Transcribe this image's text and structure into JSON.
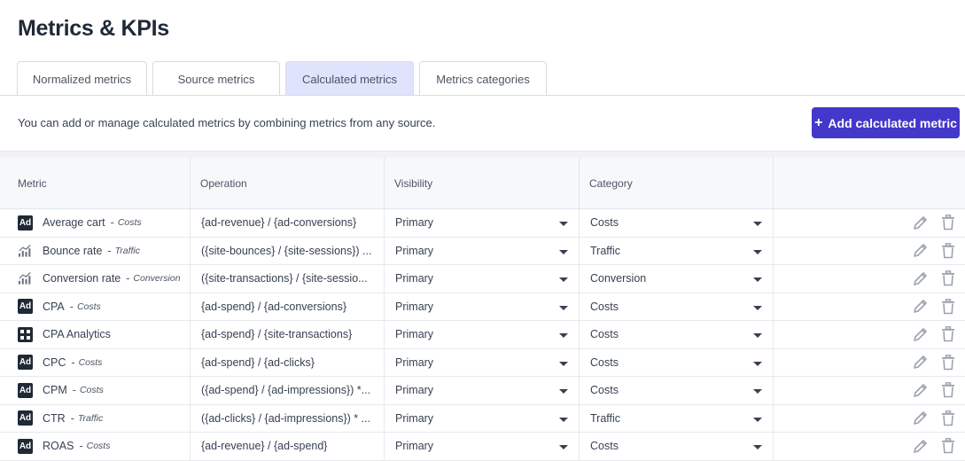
{
  "page": {
    "title": "Metrics & KPIs"
  },
  "tabs": [
    {
      "label": "Normalized metrics",
      "active": false
    },
    {
      "label": "Source metrics",
      "active": false
    },
    {
      "label": "Calculated metrics",
      "active": true
    },
    {
      "label": "Metrics categories",
      "active": false
    }
  ],
  "intro": {
    "text": "You can add or manage calculated metrics by combining metrics from any source."
  },
  "add_button": {
    "label": "Add calculated metric",
    "icon": "plus-icon"
  },
  "table": {
    "headers": [
      "Metric",
      "Operation",
      "Visibility",
      "Category",
      ""
    ],
    "rows": [
      {
        "icon": "ad-icon",
        "metric": "Average cart",
        "category_tag": "Costs",
        "operation": "{ad-revenue} / {ad-conversions}",
        "visibility": "Primary",
        "category": "Costs"
      },
      {
        "icon": "analytics-chart-icon",
        "metric": "Bounce rate",
        "category_tag": "Traffic",
        "operation": "({site-bounces} / {site-sessions}) ...",
        "visibility": "Primary",
        "category": "Traffic"
      },
      {
        "icon": "analytics-chart-icon",
        "metric": "Conversion rate",
        "category_tag": "Conversion",
        "operation": "({site-transactions} / {site-sessio...",
        "visibility": "Primary",
        "category": "Conversion"
      },
      {
        "icon": "ad-icon",
        "metric": "CPA",
        "category_tag": "Costs",
        "operation": "{ad-spend} / {ad-conversions}",
        "visibility": "Primary",
        "category": "Costs"
      },
      {
        "icon": "grid-app-icon",
        "metric": "CPA Analytics",
        "category_tag": "",
        "operation": "{ad-spend} / {site-transactions}",
        "visibility": "Primary",
        "category": "Costs"
      },
      {
        "icon": "ad-icon",
        "metric": "CPC",
        "category_tag": "Costs",
        "operation": "{ad-spend} / {ad-clicks}",
        "visibility": "Primary",
        "category": "Costs"
      },
      {
        "icon": "ad-icon",
        "metric": "CPM",
        "category_tag": "Costs",
        "operation": "({ad-spend} / {ad-impressions}) *...",
        "visibility": "Primary",
        "category": "Costs"
      },
      {
        "icon": "ad-icon",
        "metric": "CTR",
        "category_tag": "Traffic",
        "operation": "({ad-clicks} / {ad-impressions}) * ...",
        "visibility": "Primary",
        "category": "Traffic"
      },
      {
        "icon": "ad-icon",
        "metric": "ROAS",
        "category_tag": "Costs",
        "operation": "{ad-revenue} / {ad-spend}",
        "visibility": "Primary",
        "category": "Costs"
      }
    ]
  },
  "row_actions": {
    "edit_icon": "pencil-icon",
    "delete_icon": "trash-icon"
  },
  "colors": {
    "accent": "#4338ca",
    "active_tab": "#dfe3fb",
    "icon_dark": "#1f2937",
    "action_icon": "#9ca3af"
  }
}
